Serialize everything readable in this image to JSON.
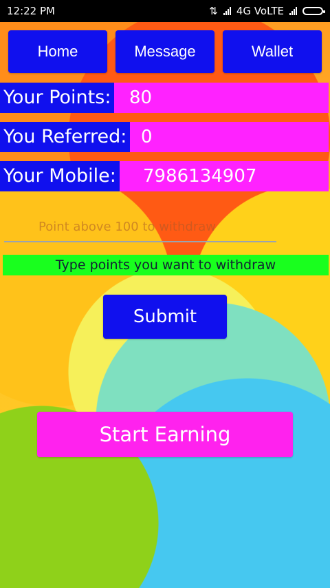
{
  "status_bar": {
    "time": "12:22 PM",
    "network": "4G VoLTE"
  },
  "nav": {
    "home": "Home",
    "message": "Message",
    "wallet": "Wallet"
  },
  "stats": {
    "points_label": "Your Points:",
    "points_value": "80",
    "referred_label": "You Referred:",
    "referred_value": "0",
    "mobile_label": "Your Mobile:",
    "mobile_value": "7986134907"
  },
  "withdraw": {
    "placeholder": "Point above 100 to withdraw",
    "hint": "Type points you want to withdraw",
    "submit_label": "Submit"
  },
  "start_earning_label": "Start Earning",
  "colors": {
    "primary_blue": "#1010ee",
    "magenta": "#ff22ff",
    "green": "#19ff1e"
  }
}
